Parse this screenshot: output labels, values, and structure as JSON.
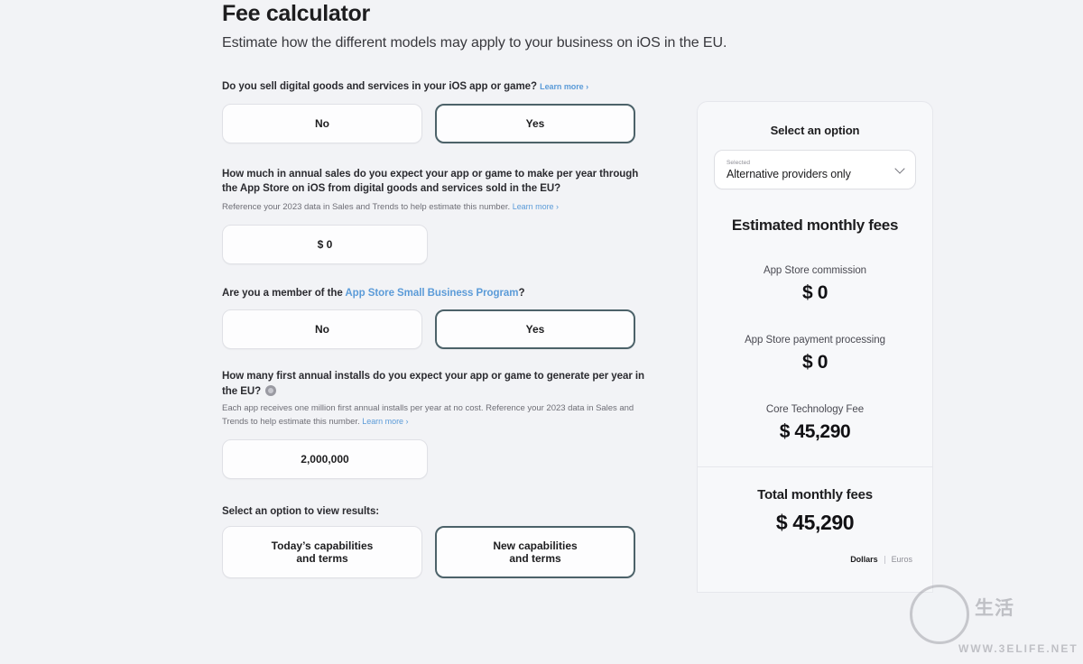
{
  "header": {
    "title": "Fee calculator",
    "subtitle": "Estimate how the different models may apply to your business on iOS in the EU."
  },
  "form": {
    "q1": {
      "label": "Do you sell digital goods and services in your iOS app or game?",
      "learn_more": "Learn more ›",
      "option_no": "No",
      "option_yes": "Yes",
      "selected": "Yes"
    },
    "q2": {
      "label": "How much in annual sales do you expect your app or game to make per year through the App Store on iOS from digital goods and services sold in the EU?",
      "help": "Reference your 2023 data in Sales and Trends to help estimate this number.",
      "learn_more": "Learn more ›",
      "value": "$ 0"
    },
    "q3": {
      "label_prefix": "Are you a member of the ",
      "label_link": "App Store Small Business Program",
      "label_suffix": "?",
      "option_no": "No",
      "option_yes": "Yes",
      "selected": "Yes"
    },
    "q4": {
      "label": "How many first annual installs do you expect your app or game to generate per year in the EU?",
      "help": "Each app receives one million first annual installs per year at no cost. Reference your 2023 data in Sales and Trends to help estimate this number.",
      "learn_more": "Learn more ›",
      "value": "2,000,000"
    },
    "results_selector": {
      "label": "Select an option to view results:",
      "option_today_line1": "Today’s capabilities",
      "option_today_line2": "and terms",
      "option_new_line1": "New capabilities",
      "option_new_line2": "and terms",
      "selected": "New capabilities and terms"
    }
  },
  "results": {
    "select_title": "Select an option",
    "dropdown": {
      "label": "Selected",
      "value": "Alternative providers only"
    },
    "fees_title": "Estimated monthly fees",
    "items": [
      {
        "name": "App Store commission",
        "value": "$ 0"
      },
      {
        "name": "App Store payment processing",
        "value": "$ 0"
      },
      {
        "name": "Core Technology Fee",
        "value": "$ 45,290"
      }
    ],
    "total_title": "Total monthly fees",
    "total_value": "$ 45,290",
    "currency": {
      "dollars": "Dollars",
      "euros": "Euros",
      "active": "Dollars"
    }
  },
  "watermark": {
    "text": "生活",
    "sub": "WWW.3ELIFE.NET"
  },
  "colors": {
    "background": "#f2f3f6",
    "selected_border": "#4c6269",
    "link": "#5b9bd8",
    "card": "#f7f8fa"
  }
}
